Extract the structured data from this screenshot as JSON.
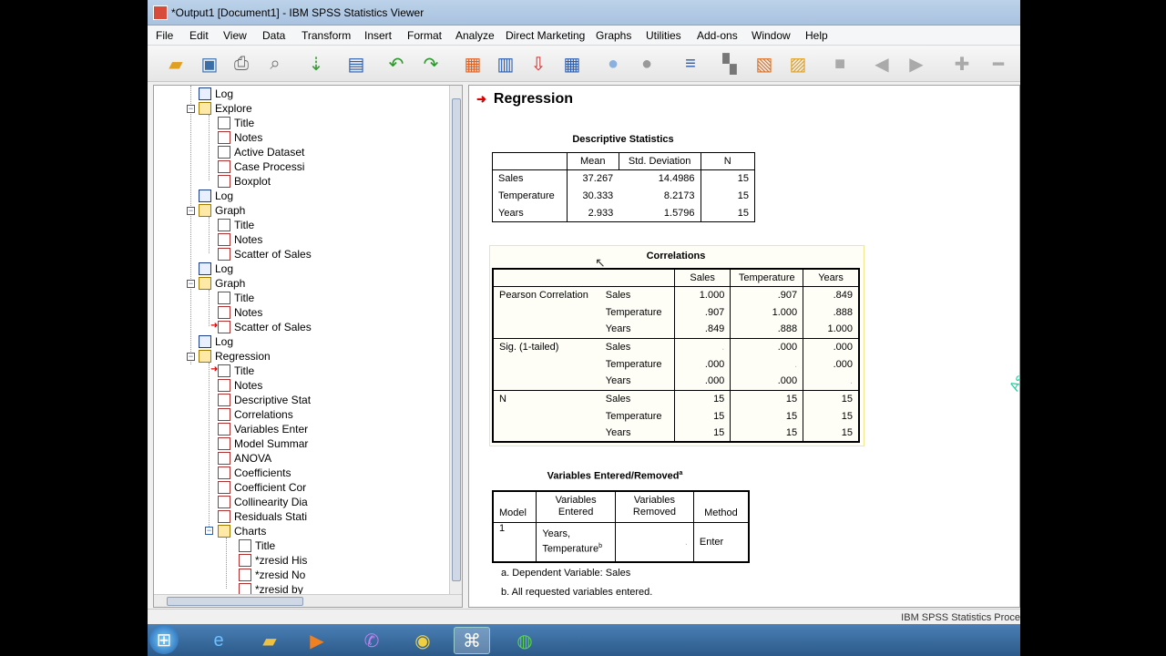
{
  "window": {
    "title": "*Output1 [Document1] - IBM SPSS Statistics Viewer"
  },
  "menu": [
    "File",
    "Edit",
    "View",
    "Data",
    "Transform",
    "Insert",
    "Format",
    "Analyze",
    "Direct Marketing",
    "Graphs",
    "Utilities",
    "Add-ons",
    "Window",
    "Help"
  ],
  "toolbar": [
    "open-icon",
    "save-icon",
    "print-icon",
    "print-preview-icon",
    "export-icon",
    "recall-dialog-icon",
    "undo-icon",
    "redo-icon",
    "goto-data-icon",
    "goto-case-icon",
    "goto-variable-icon",
    "variables-icon",
    "show-all-icon",
    "hide-icon",
    "designate-window-icon",
    "insert-heading-icon",
    "insert-title-icon",
    "insert-text-icon",
    "disabled-icon",
    "back-icon",
    "forward-icon",
    "expand-icon",
    "collapse-icon"
  ],
  "outline": {
    "items": [
      {
        "label": "Log",
        "icon": "log"
      },
      {
        "label": "Explore",
        "icon": "book"
      },
      {
        "label": "Title",
        "icon": "page"
      },
      {
        "label": "Notes",
        "icon": "notes"
      },
      {
        "label": "Active Dataset",
        "icon": "page"
      },
      {
        "label": "Case Processi",
        "icon": "chart"
      },
      {
        "label": "Boxplot",
        "icon": "chart"
      },
      {
        "label": "Log",
        "icon": "log"
      },
      {
        "label": "Graph",
        "icon": "book"
      },
      {
        "label": "Title",
        "icon": "page"
      },
      {
        "label": "Notes",
        "icon": "notes"
      },
      {
        "label": "Scatter of Sales",
        "icon": "chart"
      },
      {
        "label": "Log",
        "icon": "log"
      },
      {
        "label": "Graph",
        "icon": "book"
      },
      {
        "label": "Title",
        "icon": "page"
      },
      {
        "label": "Notes",
        "icon": "notes"
      },
      {
        "label": "Scatter of Sales",
        "icon": "chart"
      },
      {
        "label": "Log",
        "icon": "log"
      },
      {
        "label": "Regression",
        "icon": "book"
      },
      {
        "label": "Title",
        "icon": "page"
      },
      {
        "label": "Notes",
        "icon": "notes"
      },
      {
        "label": "Descriptive Stat",
        "icon": "chart"
      },
      {
        "label": "Correlations",
        "icon": "chart"
      },
      {
        "label": "Variables Enter",
        "icon": "chart"
      },
      {
        "label": "Model Summar",
        "icon": "chart"
      },
      {
        "label": "ANOVA",
        "icon": "chart"
      },
      {
        "label": "Coefficients",
        "icon": "chart"
      },
      {
        "label": "Coefficient Cor",
        "icon": "chart"
      },
      {
        "label": "Collinearity Dia",
        "icon": "chart"
      },
      {
        "label": "Residuals Stati",
        "icon": "chart"
      },
      {
        "label": "Charts",
        "icon": "book"
      },
      {
        "label": "Title",
        "icon": "page"
      },
      {
        "label": "*zresid His",
        "icon": "chart"
      },
      {
        "label": "*zresid No",
        "icon": "chart"
      },
      {
        "label": "*zresid by",
        "icon": "chart"
      }
    ]
  },
  "content": {
    "heading": "Regression",
    "descriptives": {
      "title": "Descriptive Statistics",
      "headers": [
        "",
        "Mean",
        "Std. Deviation",
        "N"
      ],
      "rows": [
        [
          "Sales",
          "37.267",
          "14.4986",
          "15"
        ],
        [
          "Temperature",
          "30.333",
          "8.2173",
          "15"
        ],
        [
          "Years",
          "2.933",
          "1.5796",
          "15"
        ]
      ]
    },
    "correlations": {
      "title": "Correlations",
      "headers": [
        "Sales",
        "Temperature",
        "Years"
      ],
      "groups": [
        "Pearson Correlation",
        "Sig. (1-tailed)",
        "N"
      ],
      "vars": [
        "Sales",
        "Temperature",
        "Years"
      ],
      "values": [
        [
          [
            "1.000",
            ".907",
            ".849"
          ],
          [
            ".907",
            "1.000",
            ".888"
          ],
          [
            ".849",
            ".888",
            "1.000"
          ]
        ],
        [
          [
            ".",
            ".000",
            ".000"
          ],
          [
            ".000",
            ".",
            ".000"
          ],
          [
            ".000",
            ".000",
            "."
          ]
        ],
        [
          [
            "15",
            "15",
            "15"
          ],
          [
            "15",
            "15",
            "15"
          ],
          [
            "15",
            "15",
            "15"
          ]
        ]
      ]
    },
    "variables_entered": {
      "title": "Variables Entered/Removed",
      "title_sup": "a",
      "h_model": "Model",
      "h_entered": "Variables Entered",
      "h_removed": "Variables Removed",
      "h_method": "Method",
      "model": "1",
      "entered": "Years, Temperature",
      "entered_sup": "b",
      "removed": ".",
      "method": "Enter",
      "note_a": "a. Dependent Variable: Sales",
      "note_b": "b. All requested variables entered."
    },
    "watermark": "Assisstant Lecture Gafel Kareem Aswed / UOK"
  },
  "status": {
    "text": "IBM SPSS Statistics Proce"
  },
  "taskbar": [
    "start-icon",
    "ie-icon",
    "explorer-icon",
    "media-icon",
    "viber-icon",
    "chrome-icon",
    "spss-icon",
    "app-icon"
  ]
}
